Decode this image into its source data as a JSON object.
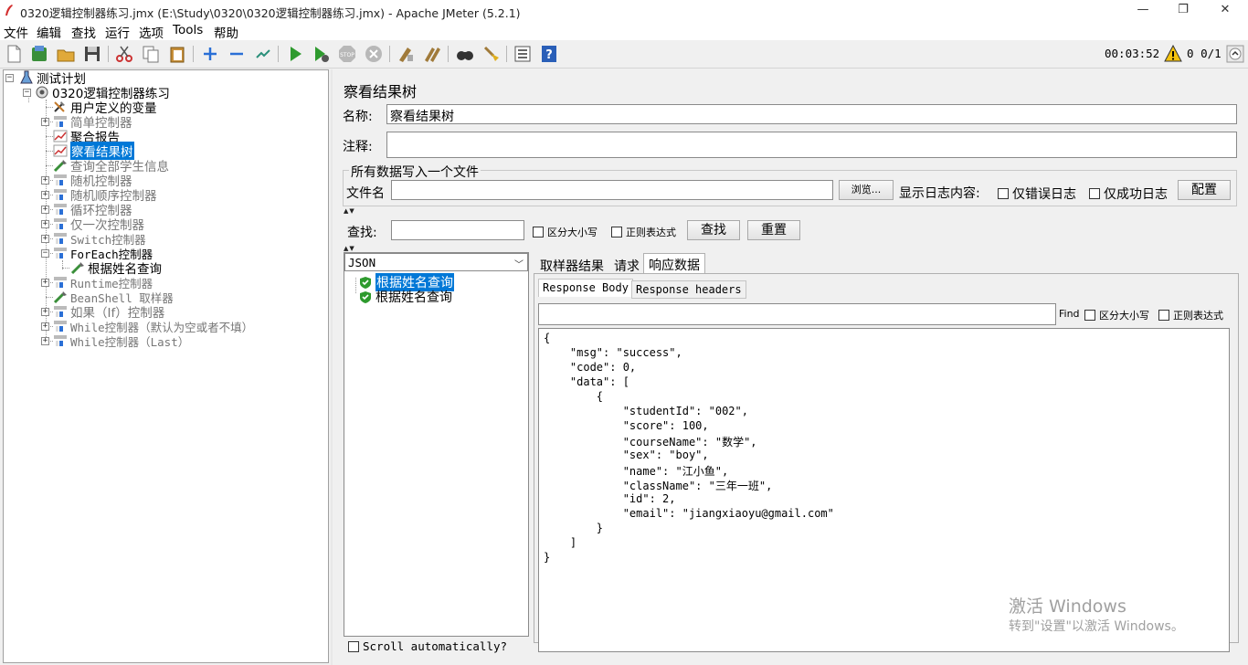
{
  "window": {
    "title": "0320逻辑控制器练习.jmx (E:\\Study\\0320\\0320逻辑控制器练习.jmx) - Apache JMeter (5.2.1)",
    "minimize": "—",
    "restore": "❐",
    "close": "✕"
  },
  "menu": [
    "文件",
    "编辑",
    "查找",
    "运行",
    "选项",
    "Tools",
    "帮助"
  ],
  "toolbar": {
    "timer": "00:03:52",
    "warnings": "0",
    "threads": "0/1",
    "icons": [
      "new-icon",
      "templates-icon",
      "open-icon",
      "save-icon",
      "cut-icon",
      "copy-icon",
      "paste-icon",
      "expand-icon",
      "collapse-icon",
      "toggle-icon",
      "start-icon",
      "start-no-pause-icon",
      "stop-icon",
      "shutdown-icon",
      "clear-icon",
      "clear-all-icon",
      "search-icon",
      "reset-search-icon",
      "function-helper-icon",
      "help-icon"
    ]
  },
  "tree": {
    "root": "测试计划",
    "plan": "0320逻辑控制器练习",
    "items": [
      {
        "label": "用户定义的变量",
        "icon": "wrench-icon",
        "expandable": false,
        "disabled": false,
        "mono": false
      },
      {
        "label": "简单控制器",
        "icon": "controller-icon",
        "expandable": true,
        "disabled": true,
        "mono": false
      },
      {
        "label": "聚合报告",
        "icon": "graph-icon",
        "expandable": false,
        "disabled": false,
        "mono": false
      },
      {
        "label": "察看结果树",
        "icon": "graph-icon",
        "expandable": false,
        "disabled": false,
        "selected": true,
        "mono": false
      },
      {
        "label": "查询全部学生信息",
        "icon": "pipette-icon",
        "expandable": false,
        "disabled": true,
        "mono": false
      },
      {
        "label": "随机控制器",
        "icon": "controller-icon",
        "expandable": true,
        "disabled": true,
        "mono": false
      },
      {
        "label": "随机顺序控制器",
        "icon": "controller-icon",
        "expandable": true,
        "disabled": true,
        "mono": false
      },
      {
        "label": "循环控制器",
        "icon": "controller-icon",
        "expandable": true,
        "disabled": true,
        "mono": false
      },
      {
        "label": "仅一次控制器",
        "icon": "controller-icon",
        "expandable": true,
        "disabled": true,
        "mono": false
      },
      {
        "label": "Switch控制器",
        "icon": "controller-icon",
        "expandable": true,
        "disabled": true,
        "mono": true
      },
      {
        "label": "ForEach控制器",
        "icon": "controller-icon",
        "expandable": true,
        "expanded": true,
        "disabled": false,
        "mono": true
      },
      {
        "label": "根据姓名查询",
        "icon": "pipette-icon",
        "expandable": false,
        "disabled": false,
        "child": true,
        "mono": false
      },
      {
        "label": "Runtime控制器",
        "icon": "controller-icon",
        "expandable": true,
        "disabled": true,
        "mono": true
      },
      {
        "label": "BeanShell 取样器",
        "icon": "pipette-icon",
        "expandable": false,
        "disabled": true,
        "mono": true
      },
      {
        "label": "如果（If）控制器",
        "icon": "controller-icon",
        "expandable": true,
        "disabled": true,
        "mono": false
      },
      {
        "label": "While控制器（默认为空或者不填）",
        "icon": "controller-icon",
        "expandable": true,
        "disabled": true,
        "mono": true
      },
      {
        "label": "While控制器（Last）",
        "icon": "controller-icon",
        "expandable": true,
        "disabled": true,
        "mono": true
      }
    ]
  },
  "panel": {
    "title": "察看结果树",
    "name_label": "名称:",
    "name_value": "察看结果树",
    "comment_label": "注释:",
    "comment_value": "",
    "file_group_title": "所有数据写入一个文件",
    "filename_label": "文件名",
    "filename_value": "",
    "browse_label": "浏览...",
    "log_label": "显示日志内容:",
    "errors_only": "仅错误日志",
    "success_only": "仅成功日志",
    "configure": "配置",
    "search_label": "查找:",
    "search_value": "",
    "case_sensitive": "区分大小写",
    "regex": "正则表达式",
    "search_button": "查找",
    "reset_button": "重置"
  },
  "results": {
    "renderer": "JSON",
    "samples": [
      "根据姓名查询",
      "根据姓名查询"
    ],
    "scroll_auto": "Scroll automatically?"
  },
  "tabs": [
    "取样器结果",
    "请求",
    "响应数据"
  ],
  "subtabs": [
    "Response Body",
    "Response headers"
  ],
  "find": {
    "label": "Find",
    "case_sensitive": "区分大小写",
    "regex": "正则表达式"
  },
  "response_lines": [
    "{",
    "    \"msg\": \"success\",",
    "    \"code\": 0,",
    "    \"data\": [",
    "        {",
    "            \"studentId\": \"002\",",
    "            \"score\": 100,",
    "            \"courseName\": \"数学\",",
    "            \"sex\": \"boy\",",
    "            \"name\": \"江小鱼\",",
    "            \"className\": \"三年一班\",",
    "            \"id\": 2,",
    "            \"email\": \"jiangxiaoyu@gmail.com\"",
    "        }",
    "    ]",
    "}"
  ],
  "watermark": {
    "line1": "激活 Windows",
    "line2": "转到\"设置\"以激活 Windows。"
  }
}
